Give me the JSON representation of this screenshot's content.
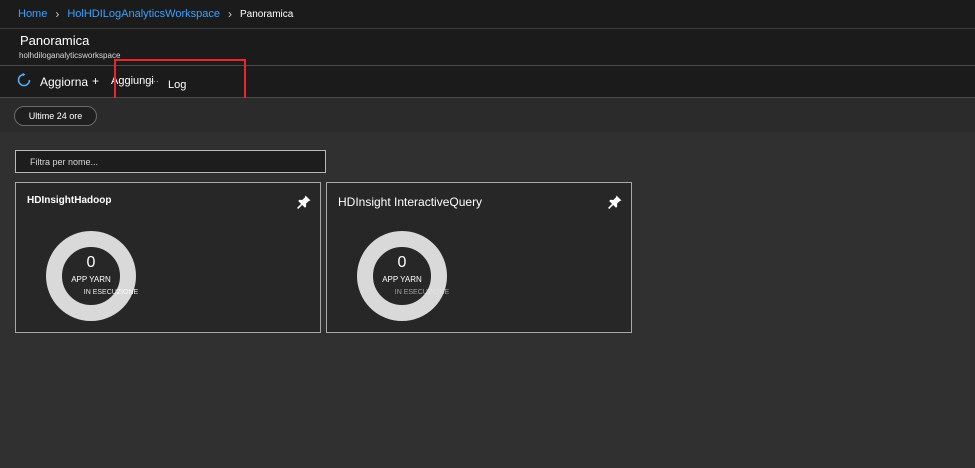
{
  "breadcrumb": {
    "home": "Home",
    "workspace": "HolHDILogAnalyticsWorkspace",
    "separator": "›",
    "current": "Panoramica"
  },
  "header": {
    "title": "Panoramica",
    "subtitle": "holhdiloganalyticsworkspace"
  },
  "toolbar": {
    "refresh_label": "Aggiorna",
    "plus": "+",
    "add_label": "Aggiungi",
    "dots": "…",
    "log_label": "Log"
  },
  "time_filter": {
    "label": "Ultime 24 ore"
  },
  "filter": {
    "placeholder": "Filtra per nome..."
  },
  "tiles": [
    {
      "title": "HDInsightHadoop",
      "count": "0",
      "label_line1": "APP YARN",
      "label_line2": "IN ESECUZIONE"
    },
    {
      "title": "HDInsight InteractiveQuery",
      "count": "0",
      "label_line1": "APP YARN",
      "label_line2": "IN ESECUZIONE"
    }
  ],
  "colors": {
    "link": "#3aa0ff",
    "highlight": "#e8262d",
    "donut_ring": "#d9d9d9"
  }
}
